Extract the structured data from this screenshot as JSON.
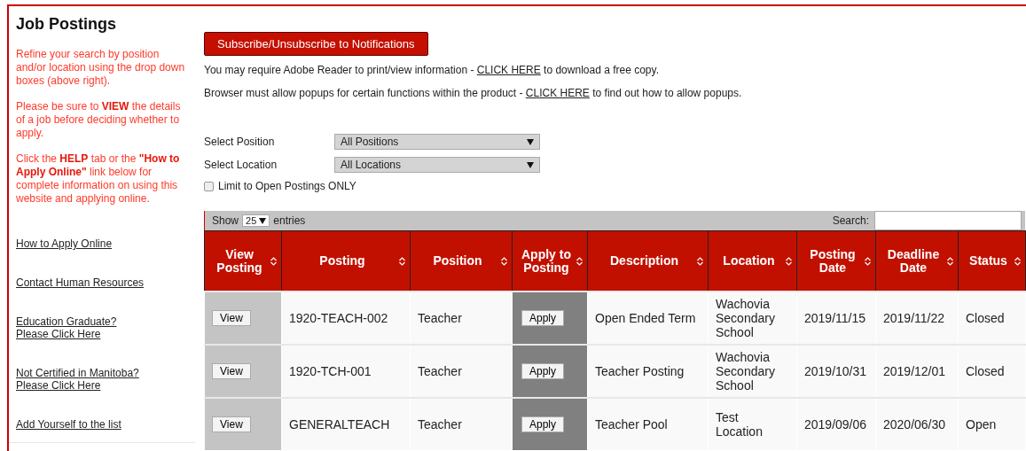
{
  "sidebar": {
    "title": "Job Postings",
    "notes": [
      "Refine your search by position and/or location using the drop down boxes (above right).",
      "Please be sure to **VIEW** the details of a job before deciding whether to apply.",
      "Click the **HELP** tab or the **\"How to Apply Online\"** link below for complete information on using this website and applying online."
    ],
    "links": [
      [
        "How to Apply Online"
      ],
      [
        "Contact Human Resources"
      ],
      [
        "Education Graduate?",
        "Please Click Here"
      ],
      [
        "Not Certified in Manitoba?",
        "Please Click Here"
      ],
      [
        "Add Yourself to the list"
      ]
    ]
  },
  "subscribe_button": "Subscribe/Unsubscribe to Notifications",
  "notices": [
    {
      "before": "You may require Adobe Reader to print/view information - ",
      "link": "CLICK HERE",
      "after": " to download a free copy."
    },
    {
      "before": "Browser must allow popups for certain functions within the product - ",
      "link": "CLICK HERE",
      "after": " to find out how to allow popups."
    }
  ],
  "filters": [
    {
      "label": "Select Position",
      "value": "All Positions"
    },
    {
      "label": "Select Location",
      "value": "All Locations"
    }
  ],
  "open_only": {
    "label": "Limit to Open Postings ONLY",
    "checked": false
  },
  "table": {
    "show_label": "Show",
    "page_size": "25",
    "entries_label": "entries",
    "search_label": "Search:",
    "columns": [
      "View Posting",
      "Posting",
      "Position",
      "Apply to Posting",
      "Description",
      "Location",
      "Posting Date",
      "Deadline Date",
      "Status"
    ],
    "rows": [
      {
        "view": "View",
        "posting": "1920-TEACH-002",
        "position": "Teacher",
        "apply": "Apply",
        "description": "Open Ended Term",
        "location": "Wachovia Secondary School",
        "posting_date": "2019/11/15",
        "deadline": "2019/11/22",
        "status": "Closed"
      },
      {
        "view": "View",
        "posting": "1920-TCH-001",
        "position": "Teacher",
        "apply": "Apply",
        "description": "Teacher Posting",
        "location": "Wachovia Secondary School",
        "posting_date": "2019/10/31",
        "deadline": "2019/12/01",
        "status": "Closed"
      },
      {
        "view": "View",
        "posting": "GENERALTEACH",
        "position": "Teacher",
        "apply": "Apply",
        "description": "Teacher Pool",
        "location": "Test Location",
        "posting_date": "2019/09/06",
        "deadline": "2020/06/30",
        "status": "Open"
      }
    ]
  }
}
